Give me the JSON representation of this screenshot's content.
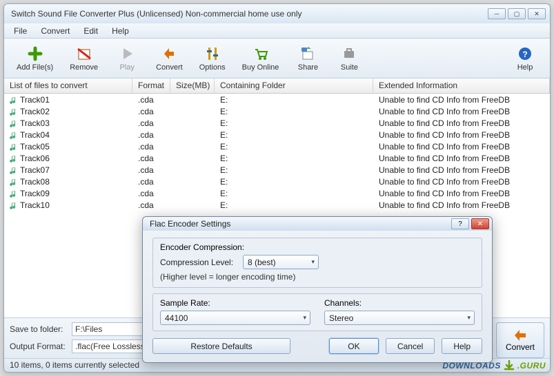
{
  "window": {
    "title": "Switch Sound File Converter Plus (Unlicensed) Non-commercial home use only"
  },
  "menu": {
    "file": "File",
    "convert": "Convert",
    "edit": "Edit",
    "help": "Help"
  },
  "toolbar": {
    "add": "Add File(s)",
    "remove": "Remove",
    "play": "Play",
    "convert": "Convert",
    "options": "Options",
    "buy": "Buy Online",
    "share": "Share",
    "suite": "Suite",
    "help": "Help"
  },
  "columns": {
    "file": "List of files to convert",
    "format": "Format",
    "size": "Size(MB)",
    "folder": "Containing Folder",
    "ext": "Extended Information"
  },
  "files": [
    {
      "name": "Track01",
      "fmt": ".cda",
      "folder": "E:",
      "ext": "Unable to find CD Info from FreeDB"
    },
    {
      "name": "Track02",
      "fmt": ".cda",
      "folder": "E:",
      "ext": "Unable to find CD Info from FreeDB"
    },
    {
      "name": "Track03",
      "fmt": ".cda",
      "folder": "E:",
      "ext": "Unable to find CD Info from FreeDB"
    },
    {
      "name": "Track04",
      "fmt": ".cda",
      "folder": "E:",
      "ext": "Unable to find CD Info from FreeDB"
    },
    {
      "name": "Track05",
      "fmt": ".cda",
      "folder": "E:",
      "ext": "Unable to find CD Info from FreeDB"
    },
    {
      "name": "Track06",
      "fmt": ".cda",
      "folder": "E:",
      "ext": "Unable to find CD Info from FreeDB"
    },
    {
      "name": "Track07",
      "fmt": ".cda",
      "folder": "E:",
      "ext": "Unable to find CD Info from FreeDB"
    },
    {
      "name": "Track08",
      "fmt": ".cda",
      "folder": "E:",
      "ext": "Unable to find CD Info from FreeDB"
    },
    {
      "name": "Track09",
      "fmt": ".cda",
      "folder": "E:",
      "ext": "Unable to find CD Info from FreeDB"
    },
    {
      "name": "Track10",
      "fmt": ".cda",
      "folder": "E:",
      "ext": "Unable to find CD Info from FreeDB"
    }
  ],
  "bottom": {
    "save_label": "Save to folder:",
    "save_value": "F:\\Files",
    "format_label": "Output Format:",
    "format_value": ".flac(Free Lossless Audio Codec)",
    "convert": "Convert"
  },
  "status": "10 items, 0 items currently selected",
  "dialog": {
    "title": "Flac Encoder Settings",
    "encoder_section": "Encoder Compression:",
    "compression_label": "Compression Level:",
    "compression_value": "8 (best)",
    "hint": "(Higher level = longer encoding time)",
    "sample_label": "Sample Rate:",
    "sample_value": "44100",
    "channels_label": "Channels:",
    "channels_value": "Stereo",
    "restore": "Restore Defaults",
    "ok": "OK",
    "cancel": "Cancel",
    "help": "Help"
  },
  "watermark": {
    "a": "DOWNLOADS",
    "b": ".GURU"
  }
}
